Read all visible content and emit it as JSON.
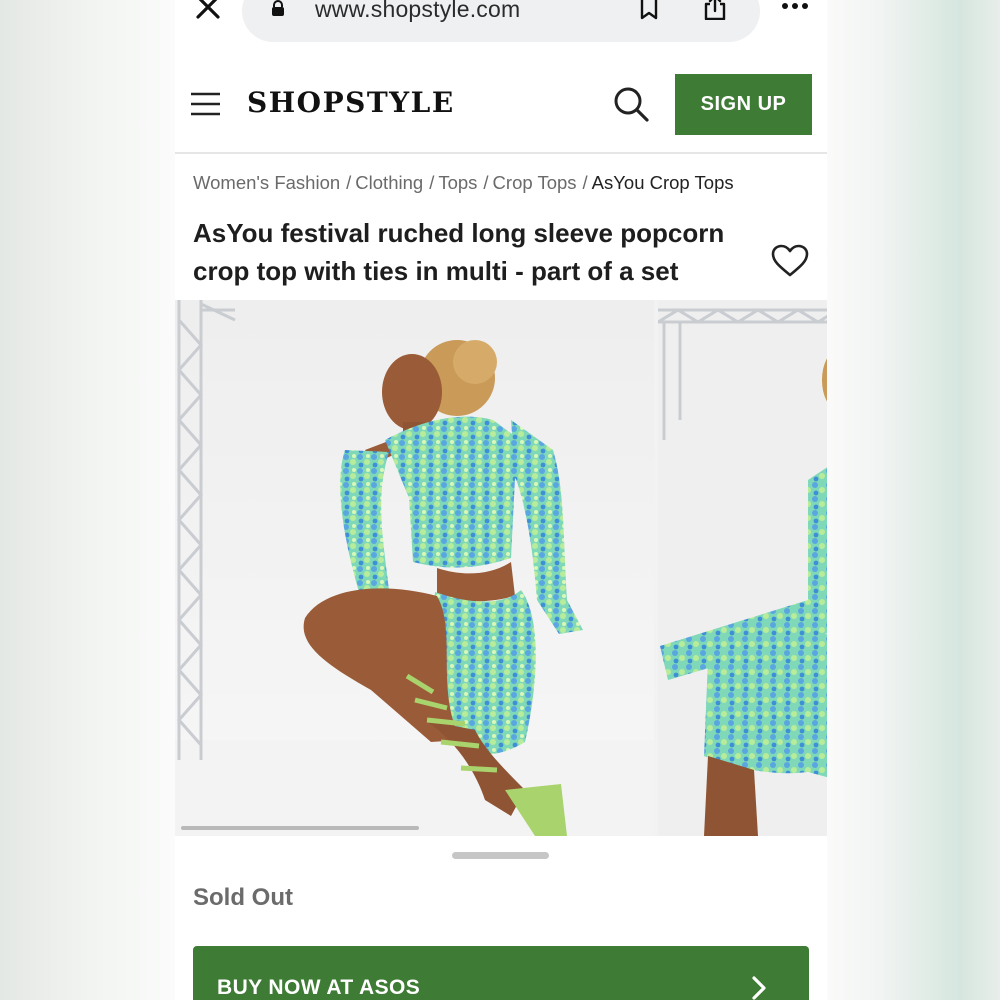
{
  "browser": {
    "url": "www.shopstyle.com",
    "icons": [
      "close-icon",
      "lock-icon",
      "bookmark-icon",
      "share-icon",
      "more-icon"
    ]
  },
  "header": {
    "logo": "SHOPSTYLE",
    "signup_label": "SIGN UP",
    "icons": [
      "menu-icon",
      "search-icon"
    ],
    "accent_color": "#3e7b34"
  },
  "breadcrumb": {
    "items": [
      "Women's Fashion",
      "Clothing",
      "Tops",
      "Crop Tops",
      "AsYou Crop Tops"
    ],
    "separator": "/"
  },
  "product": {
    "brand": "AsYou",
    "title": " festival ruched long sleeve popcorn crop top with ties in multi - part of a set",
    "favorite_icon": "heart-icon",
    "status": "Sold Out",
    "buy_label": "BUY NOW AT ASOS",
    "buy_icon": "chevron-right-icon"
  },
  "gallery": {
    "image_count_visible": 2
  }
}
